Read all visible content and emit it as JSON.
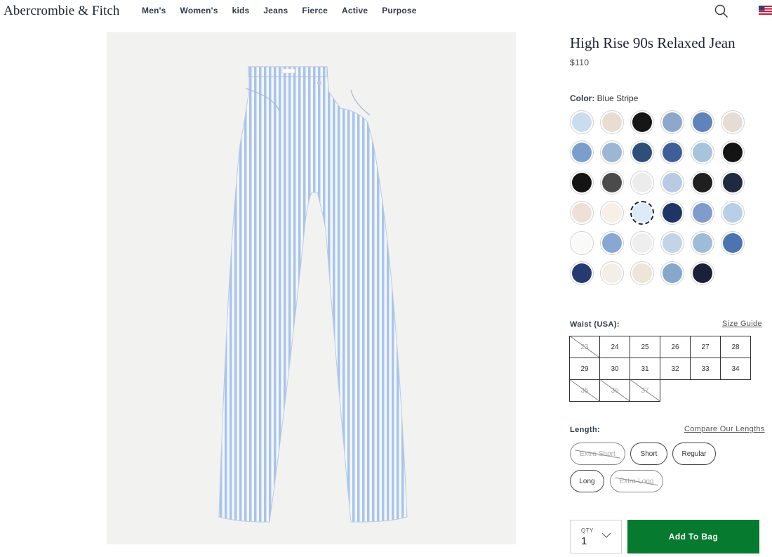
{
  "header": {
    "logo": "Abercrombie & Fitch",
    "nav": [
      "Men's",
      "Women's",
      "kids",
      "Jeans",
      "Fierce",
      "Active",
      "Purpose"
    ]
  },
  "product": {
    "title": "High Rise 90s Relaxed Jean",
    "price": "$110",
    "color_label": "Color:",
    "color_value": "Blue Stripe",
    "selected_swatch_index": 20,
    "swatch_colors": [
      "#c9ddef",
      "#e9ddd2",
      "#161616",
      "#8ea8cc",
      "#5f83ba",
      "#e6dcd6",
      "#7b9fcc",
      "#9db6d6",
      "#2e4f7a",
      "#3e5f97",
      "#a9c3dd",
      "#141414",
      "#141414",
      "#4b4b4b",
      "#ececec",
      "#b8cbe2",
      "#1f1f1f",
      "#1e2a40",
      "#eee0d6",
      "#f6f0e6",
      "#ddeaf8",
      "#1f3566",
      "#7f9ccc",
      "#b9cfe8",
      "#fafaf8",
      "#86a8d2",
      "#eeeeee",
      "#c2d4e8",
      "#9ebbd8",
      "#4b74b1",
      "#243b72",
      "#f4efe6",
      "#ede6d8",
      "#86a8ca",
      "#1a2038"
    ]
  },
  "waist": {
    "label": "Waist (USA):",
    "size_guide": "Size Guide",
    "sizes": [
      "23",
      "24",
      "25",
      "26",
      "27",
      "28",
      "29",
      "30",
      "31",
      "32",
      "33",
      "34",
      "35",
      "36",
      "37"
    ],
    "unavailable": [
      "23",
      "35",
      "36",
      "37"
    ]
  },
  "length": {
    "label": "Length:",
    "compare": "Compare Our Lengths",
    "options": [
      "Extra-Short",
      "Short",
      "Regular",
      "Long",
      "Extra-Long"
    ],
    "unavailable": [
      "Extra-Short",
      "Extra-Long"
    ]
  },
  "cart": {
    "qty_label": "QTY",
    "qty_value": "1",
    "add_label": "Add To Bag"
  }
}
